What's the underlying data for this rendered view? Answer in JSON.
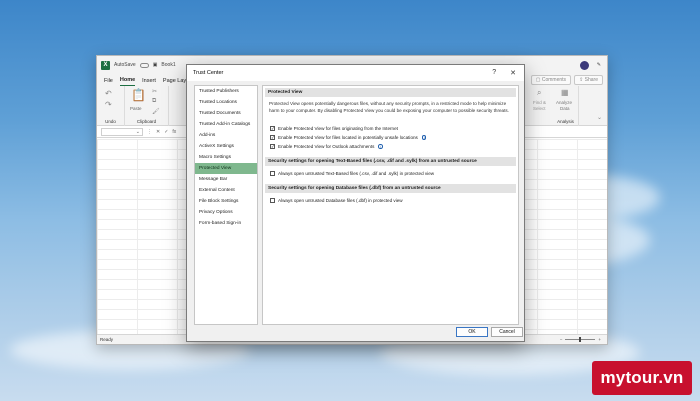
{
  "excel": {
    "logo": "X",
    "autosave_label": "AutoSave",
    "title_fragment": "Book1",
    "menu": [
      "File",
      "Home",
      "Insert",
      "Page Lay"
    ],
    "menu_active": "Home",
    "comments_label": "Comments",
    "share_label": "Share",
    "ribbon": {
      "undo_label": "Undo",
      "clipboard_label": "Clipboard",
      "paste_label": "Paste",
      "find_label": "Find &",
      "select_label": "Select",
      "analyze_label": "Analyze",
      "data_label": "Data",
      "analysis_label": "Analysis"
    },
    "formula_bar": {
      "fx": "fx"
    },
    "status": "Ready"
  },
  "dialog": {
    "title": "Trust Center",
    "help_glyph": "?",
    "close_glyph": "✕",
    "nav_items": [
      "Trusted Publishers",
      "Trusted Locations",
      "Trusted Documents",
      "Trusted Add-in Catalogs",
      "Add-ins",
      "ActiveX Settings",
      "Macro Settings",
      "Protected View",
      "Message Bar",
      "External Content",
      "File Block Settings",
      "Privacy Options",
      "Form-based Sign-in"
    ],
    "selected_nav": "Protected View",
    "section1": {
      "heading": "Protected View",
      "description": "Protected View opens potentially dangerous files, without any security prompts, in a restricted mode to help minimize harm to your computer. By disabling Protected View you could be exposing your computer to possible security threats.",
      "options": [
        {
          "label": "Enable Protected View for files originating from the Internet",
          "checked": true,
          "info": false
        },
        {
          "label": "Enable Protected View for files located in potentially unsafe locations",
          "checked": true,
          "info": true
        },
        {
          "label": "Enable Protected View for Outlook attachments",
          "checked": true,
          "info": true
        }
      ]
    },
    "section2": {
      "heading": "Security settings for opening Text-Based files (.csv, .dif and .sylk) from an untrusted source",
      "option": {
        "label": "Always open untrusted Text-Based files (.csv, .dif and .sylk) in protected view",
        "checked": false
      }
    },
    "section3": {
      "heading": "Security settings for opening Database files (.dbf) from an untrusted source",
      "option": {
        "label": "Always open untrusted Database files (.dbf) in protected view",
        "checked": false
      }
    },
    "ok_label": "OK",
    "cancel_label": "Cancel",
    "info_glyph": "i"
  },
  "watermark": {
    "text": "mytour.vn"
  },
  "colors": {
    "excel_green": "#1d6f42",
    "selected_nav": "#7fb88e",
    "watermark_red": "#c8102e"
  }
}
